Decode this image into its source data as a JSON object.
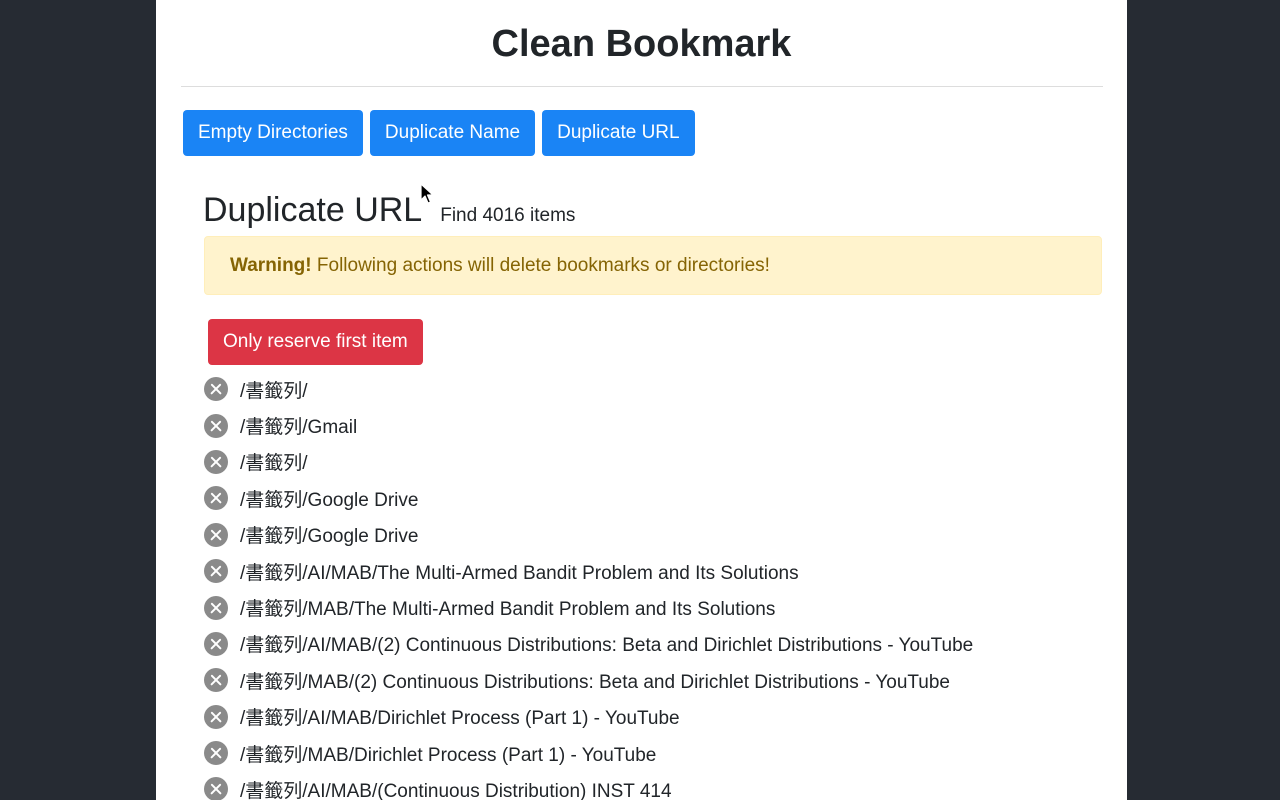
{
  "header": {
    "title": "Clean Bookmark"
  },
  "tabs": [
    {
      "label": "Empty Directories"
    },
    {
      "label": "Duplicate Name"
    },
    {
      "label": "Duplicate URL"
    }
  ],
  "section": {
    "title": "Duplicate URL",
    "count_text": "Find 4016 items"
  },
  "alert": {
    "strong": "Warning!",
    "message": " Following actions will delete bookmarks or directories!"
  },
  "actions": {
    "reserve_label": "Only reserve first item"
  },
  "items": [
    {
      "path": "/書籤列/"
    },
    {
      "path": "/書籤列/Gmail"
    },
    {
      "path": "/書籤列/"
    },
    {
      "path": "/書籤列/Google Drive"
    },
    {
      "path": "/書籤列/Google Drive"
    },
    {
      "path": "/書籤列/AI/MAB/The Multi-Armed Bandit Problem and Its Solutions"
    },
    {
      "path": "/書籤列/MAB/The Multi-Armed Bandit Problem and Its Solutions"
    },
    {
      "path": "/書籤列/AI/MAB/(2) Continuous Distributions: Beta and Dirichlet Distributions - YouTube"
    },
    {
      "path": "/書籤列/MAB/(2) Continuous Distributions: Beta and Dirichlet Distributions - YouTube"
    },
    {
      "path": "/書籤列/AI/MAB/Dirichlet Process (Part 1) - YouTube"
    },
    {
      "path": "/書籤列/MAB/Dirichlet Process (Part 1) - YouTube"
    },
    {
      "path": "/書籤列/AI/MAB/(Continuous Distribution) INST 414"
    }
  ],
  "colors": {
    "background": "#262b33",
    "primary": "#1a84f5",
    "danger": "#dc3545",
    "warning_bg": "#fff3cd",
    "warning_text": "#856404",
    "icon_gray": "#8a8a8a"
  },
  "icons": {
    "remove": "close-circle-icon",
    "cursor": "mouse-pointer-icon"
  }
}
